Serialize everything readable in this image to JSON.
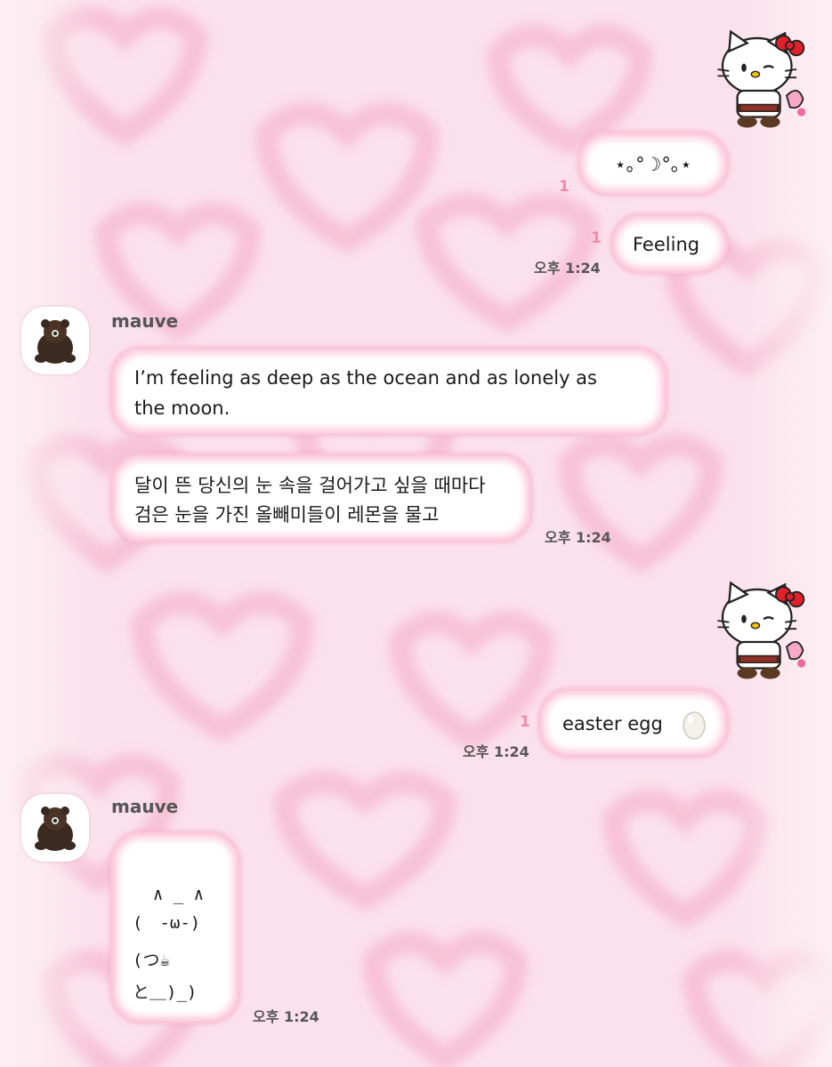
{
  "colors": {
    "background": "#fbe3ec",
    "bubble": "#ffffff",
    "bubble_glow": "#fbc2d6",
    "unread": "#f08aa6"
  },
  "messages": [
    {
      "side": "right",
      "type": "sticker",
      "sticker": "hello-kitty-wink-sticker"
    },
    {
      "side": "right",
      "type": "text",
      "text": "⋆｡°☽°｡⋆",
      "unread": "1"
    },
    {
      "side": "right",
      "type": "text",
      "text": "Feeling",
      "unread": "1",
      "time": "오후 1:24"
    },
    {
      "side": "left",
      "sender": "mauve",
      "avatar": "brown-teddy-bear-avatar",
      "type": "text",
      "lines": [
        "I’m feeling as deep as the ocean and as lonely as",
        "the moon."
      ]
    },
    {
      "side": "left",
      "type": "text",
      "lines": [
        "달이 뜬 당신의 눈 속을 걸어가고 싶을 때마다",
        "검은 눈을 가진 올빼미들이 레몬을 물고"
      ],
      "time": "오후 1:24"
    },
    {
      "side": "right",
      "type": "sticker",
      "sticker": "hello-kitty-wink-sticker"
    },
    {
      "side": "right",
      "type": "text",
      "text": "easter egg",
      "emoji": "egg-emoji",
      "unread": "1",
      "time": "오후 1:24"
    },
    {
      "side": "left",
      "sender": "mauve",
      "avatar": "brown-teddy-bear-avatar",
      "type": "text",
      "lines": [
        "  ∧ _ ∧",
        "(　-ω-)",
        "(つ☕",
        "と＿)_)"
      ],
      "time": "오후 1:24"
    }
  ]
}
